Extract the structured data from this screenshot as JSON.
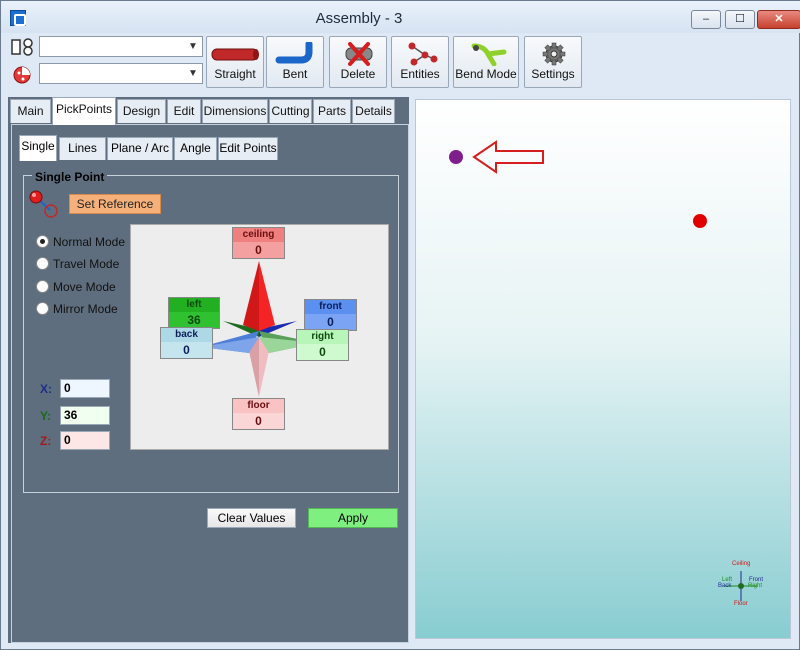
{
  "window": {
    "title": "Assembly - 3",
    "controls": {
      "minimize": "–",
      "maximize": "☐",
      "close": "✕"
    }
  },
  "toolbar": {
    "combo_pipe": {
      "value": ""
    },
    "combo_material": {
      "value": ""
    },
    "buttons": {
      "straight": "Straight",
      "bent": "Bent",
      "delete": "Delete",
      "entities": "Entities",
      "bend_mode": "Bend Mode",
      "settings": "Settings"
    }
  },
  "tabs": [
    "Main",
    "PickPoints",
    "Design",
    "Edit",
    "Dimensions",
    "Cutting",
    "Parts",
    "Details"
  ],
  "active_tab": "PickPoints",
  "subtabs": [
    "Single",
    "Lines",
    "Plane / Arc",
    "Angle",
    "Edit Points"
  ],
  "active_subtab": "Single",
  "single_point": {
    "group_title": "Single Point",
    "set_reference": "Set Reference",
    "modes": [
      {
        "label": "Normal Mode",
        "selected": true
      },
      {
        "label": "Travel Mode",
        "selected": false
      },
      {
        "label": "Move Mode",
        "selected": false
      },
      {
        "label": "Mirror Mode",
        "selected": false
      }
    ],
    "directions": {
      "ceiling": {
        "label": "ceiling",
        "value": "0"
      },
      "left": {
        "label": "left",
        "value": "36"
      },
      "front": {
        "label": "front",
        "value": "0"
      },
      "back": {
        "label": "back",
        "value": "0"
      },
      "right": {
        "label": "right",
        "value": "0"
      },
      "floor": {
        "label": "floor",
        "value": "0"
      }
    },
    "coords": {
      "x": {
        "label": "X:",
        "value": "0"
      },
      "y": {
        "label": "Y:",
        "value": "36"
      },
      "z": {
        "label": "Z:",
        "value": "0"
      }
    },
    "clear_values": "Clear Values",
    "apply": "Apply"
  },
  "viewport": {
    "axes": {
      "ceiling": "Ceiling",
      "left": "Left",
      "back": "Back",
      "front": "Front",
      "right": "Right",
      "floor": "Floor"
    }
  },
  "colors": {
    "ceiling": "#f08080",
    "left": "#22b022",
    "front": "#5b8ff0",
    "back": "#add8e6",
    "right": "#b8f5b8",
    "floor": "#f9c3c3",
    "apply": "#7ff07f",
    "set_reference": "#f6b17a",
    "point_selected": "#7f1f8c",
    "point_other": "#e00000"
  }
}
